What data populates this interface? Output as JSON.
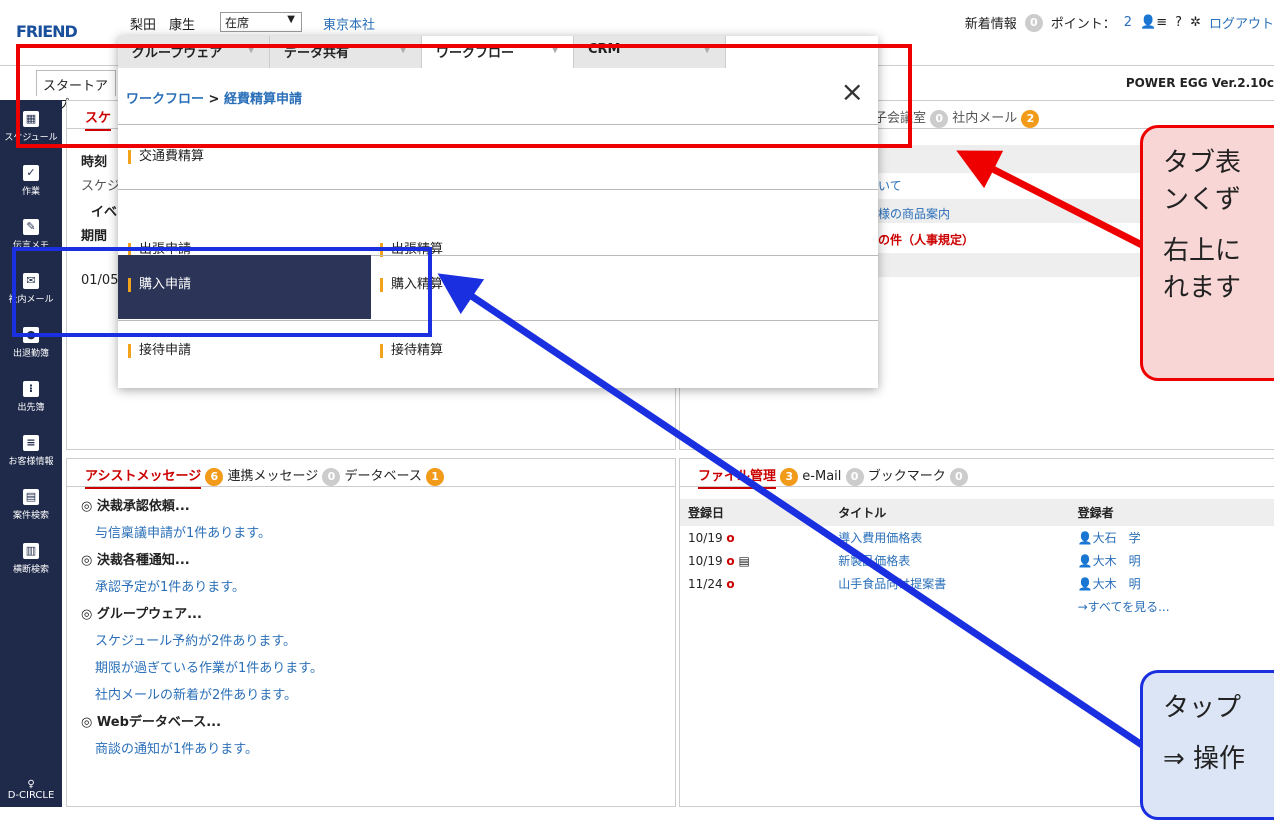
{
  "header": {
    "logo_prefix": "F",
    "logo_text": "FRIEND",
    "user_name": "梨田　康生",
    "status": "在席",
    "office": "東京本社",
    "news_label": "新着情報",
    "news_count": "0",
    "points_label": "ポイント：",
    "points_value": "2",
    "help": "?",
    "logout": "ログアウト"
  },
  "startup_tab": "スタートアップ",
  "version": "POWER EGG Ver.2.10c",
  "sidebar": {
    "items": [
      {
        "label": "スケジュール"
      },
      {
        "label": "作業"
      },
      {
        "label": "伝言メモ"
      },
      {
        "label": "社内メール"
      },
      {
        "label": "出退勤簿"
      },
      {
        "label": "出先簿"
      },
      {
        "label": "お客様情報"
      },
      {
        "label": "案件検索"
      },
      {
        "label": "横断検索"
      }
    ],
    "brand": "D-CIRCLE"
  },
  "top_left_panel": {
    "tab_active": "スケ",
    "time_label": "時刻",
    "schedule_label": "スケジ",
    "event_label": "イベ",
    "period_label": "期間",
    "date_value": "01/05"
  },
  "top_right_panel": {
    "tab_meeting": "子会議室",
    "meeting_count": "0",
    "tab_mail": "社内メール",
    "mail_count": "2",
    "rows": [
      "いて",
      "品様の商品案内",
      "定の件（人事規定）"
    ]
  },
  "flyout": {
    "tabs": [
      {
        "label": "グループウェア"
      },
      {
        "label": "データ共有"
      },
      {
        "label": "ワークフロー"
      },
      {
        "label": "CRM"
      }
    ],
    "breadcrumb_link": "ワークフロー",
    "breadcrumb_sep": " > ",
    "breadcrumb_current": "経費精算申請",
    "close": "×",
    "items": {
      "transport": "交通費精算",
      "trip_request": "出張申請",
      "trip_settle": "出張精算",
      "purchase_request": "購入申請",
      "purchase_settle": "購入精算",
      "entertain_request": "接待申請",
      "entertain_settle": "接待精算"
    }
  },
  "assist_panel": {
    "tabs": [
      {
        "label": "アシストメッセージ",
        "count": "6"
      },
      {
        "label": "連携メッセージ",
        "count": "0"
      },
      {
        "label": "データベース",
        "count": "1"
      }
    ],
    "groups": [
      {
        "head": "決裁承認依頼...",
        "links": [
          "与信稟議申請が1件あります。"
        ]
      },
      {
        "head": "決裁各種通知...",
        "links": [
          "承認予定が1件あります。"
        ]
      },
      {
        "head": "グループウェア...",
        "links": [
          "スケジュール予約が2件あります。",
          "期限が過ぎている作業が1件あります。",
          "社内メールの新着が2件あります。"
        ]
      },
      {
        "head": "Webデータベース...",
        "links": [
          "商談の通知が1件あります。"
        ]
      }
    ]
  },
  "file_panel": {
    "tabs": [
      {
        "label": "ファイル管理",
        "count": "3"
      },
      {
        "label": "e-Mail",
        "count": "0"
      },
      {
        "label": "ブックマーク",
        "count": "0"
      }
    ],
    "columns": [
      "登録日",
      "タイトル",
      "登録者"
    ],
    "rows": [
      {
        "date": "10/19",
        "title": "導入費用価格表",
        "owner": "大石　学"
      },
      {
        "date": "10/19",
        "title": "新製品価格表",
        "owner": "大木　明"
      },
      {
        "date": "11/24",
        "title": "山手食品向け提案書",
        "owner": "大木　明"
      }
    ],
    "see_all": "→すべてを見る..."
  },
  "callouts": {
    "red_line1": "タブ表",
    "red_line2": "ンくず",
    "red_line3": "右上に",
    "red_line4": "れます",
    "blue_line1": "タップ",
    "blue_line2": "⇒ 操作"
  },
  "colors": {
    "red": "#e00000",
    "blue": "#1a2fe0",
    "sidebar": "#1f2a4a",
    "accent_orange": "#f2a31b"
  }
}
